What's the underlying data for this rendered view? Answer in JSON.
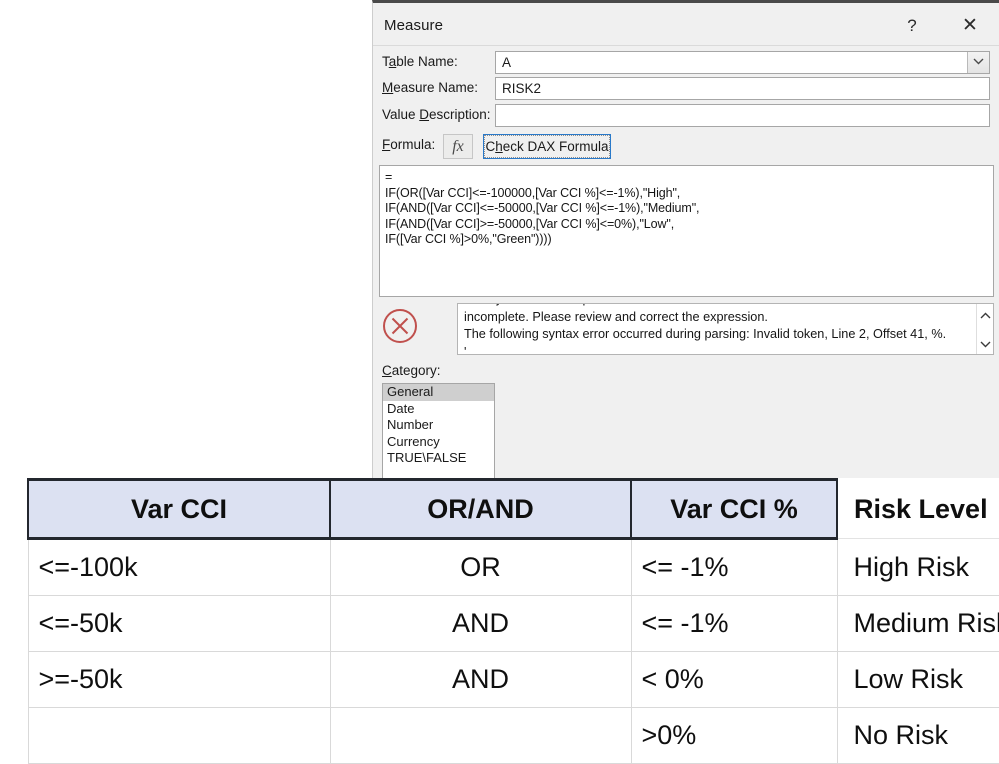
{
  "dialog": {
    "title": "Measure",
    "help_label": "?",
    "close_label": "✕",
    "fields": {
      "table_name_label_pre": "T",
      "table_name_label_accel": "a",
      "table_name_label_post": "ble Name:",
      "table_name_value": "A",
      "measure_name_label_pre": "",
      "measure_name_label_accel": "M",
      "measure_name_label_post": "easure Name:",
      "measure_name_value": "RISK2",
      "value_description_label_pre": "Value ",
      "value_description_label_accel": "D",
      "value_description_label_post": "escription:",
      "value_description_value": "",
      "formula_label_pre": "",
      "formula_label_accel": "F",
      "formula_label_post": "ormula:"
    },
    "fx_button_label": "fx",
    "check_dax_button_pre": "C",
    "check_dax_button_accel": "h",
    "check_dax_button_post": "eck DAX Formula",
    "formula_text": "=\nIF(OR([Var CCI]<=-100000,[Var CCI %]<=-1%),\"High\",\nIF(AND([Var CCI]<=-50000,[Var CCI %]<=-1%),\"Medium\",\nIF(AND([Var CCI]>=-50000,[Var CCI %]<=0%),\"Low\",\nIF([Var CCI %]>0%,\"Green\"))))",
    "error_text": "The syntax for the expression is\nincomplete. Please review and correct the expression.\nThe following syntax error occurred during parsing: Invalid token, Line 2, Offset 41, %.\n'.",
    "error_icon_color": "#c0504d",
    "category_label_pre": "",
    "category_label_accel": "C",
    "category_label_post": "ategory:",
    "category_items": [
      {
        "label": "General",
        "selected": true
      },
      {
        "label": "Date",
        "selected": false
      },
      {
        "label": "Number",
        "selected": false
      },
      {
        "label": "Currency",
        "selected": false
      },
      {
        "label": "TRUE\\FALSE",
        "selected": false
      }
    ],
    "accent_focus_color": "#2979c9"
  },
  "table": {
    "headers": [
      "Var CCI",
      "OR/AND",
      "Var CCI %",
      "Risk Level"
    ],
    "header_fill": "#dce1f2",
    "rows": [
      [
        "<=-100k",
        "OR",
        "<= -1%",
        "High Risk"
      ],
      [
        "<=-50k",
        "AND",
        "<= -1%",
        "Medium Risk"
      ],
      [
        ">=-50k",
        "AND",
        "< 0%",
        "Low Risk"
      ],
      [
        "",
        "",
        ">0%",
        "No Risk"
      ]
    ]
  }
}
